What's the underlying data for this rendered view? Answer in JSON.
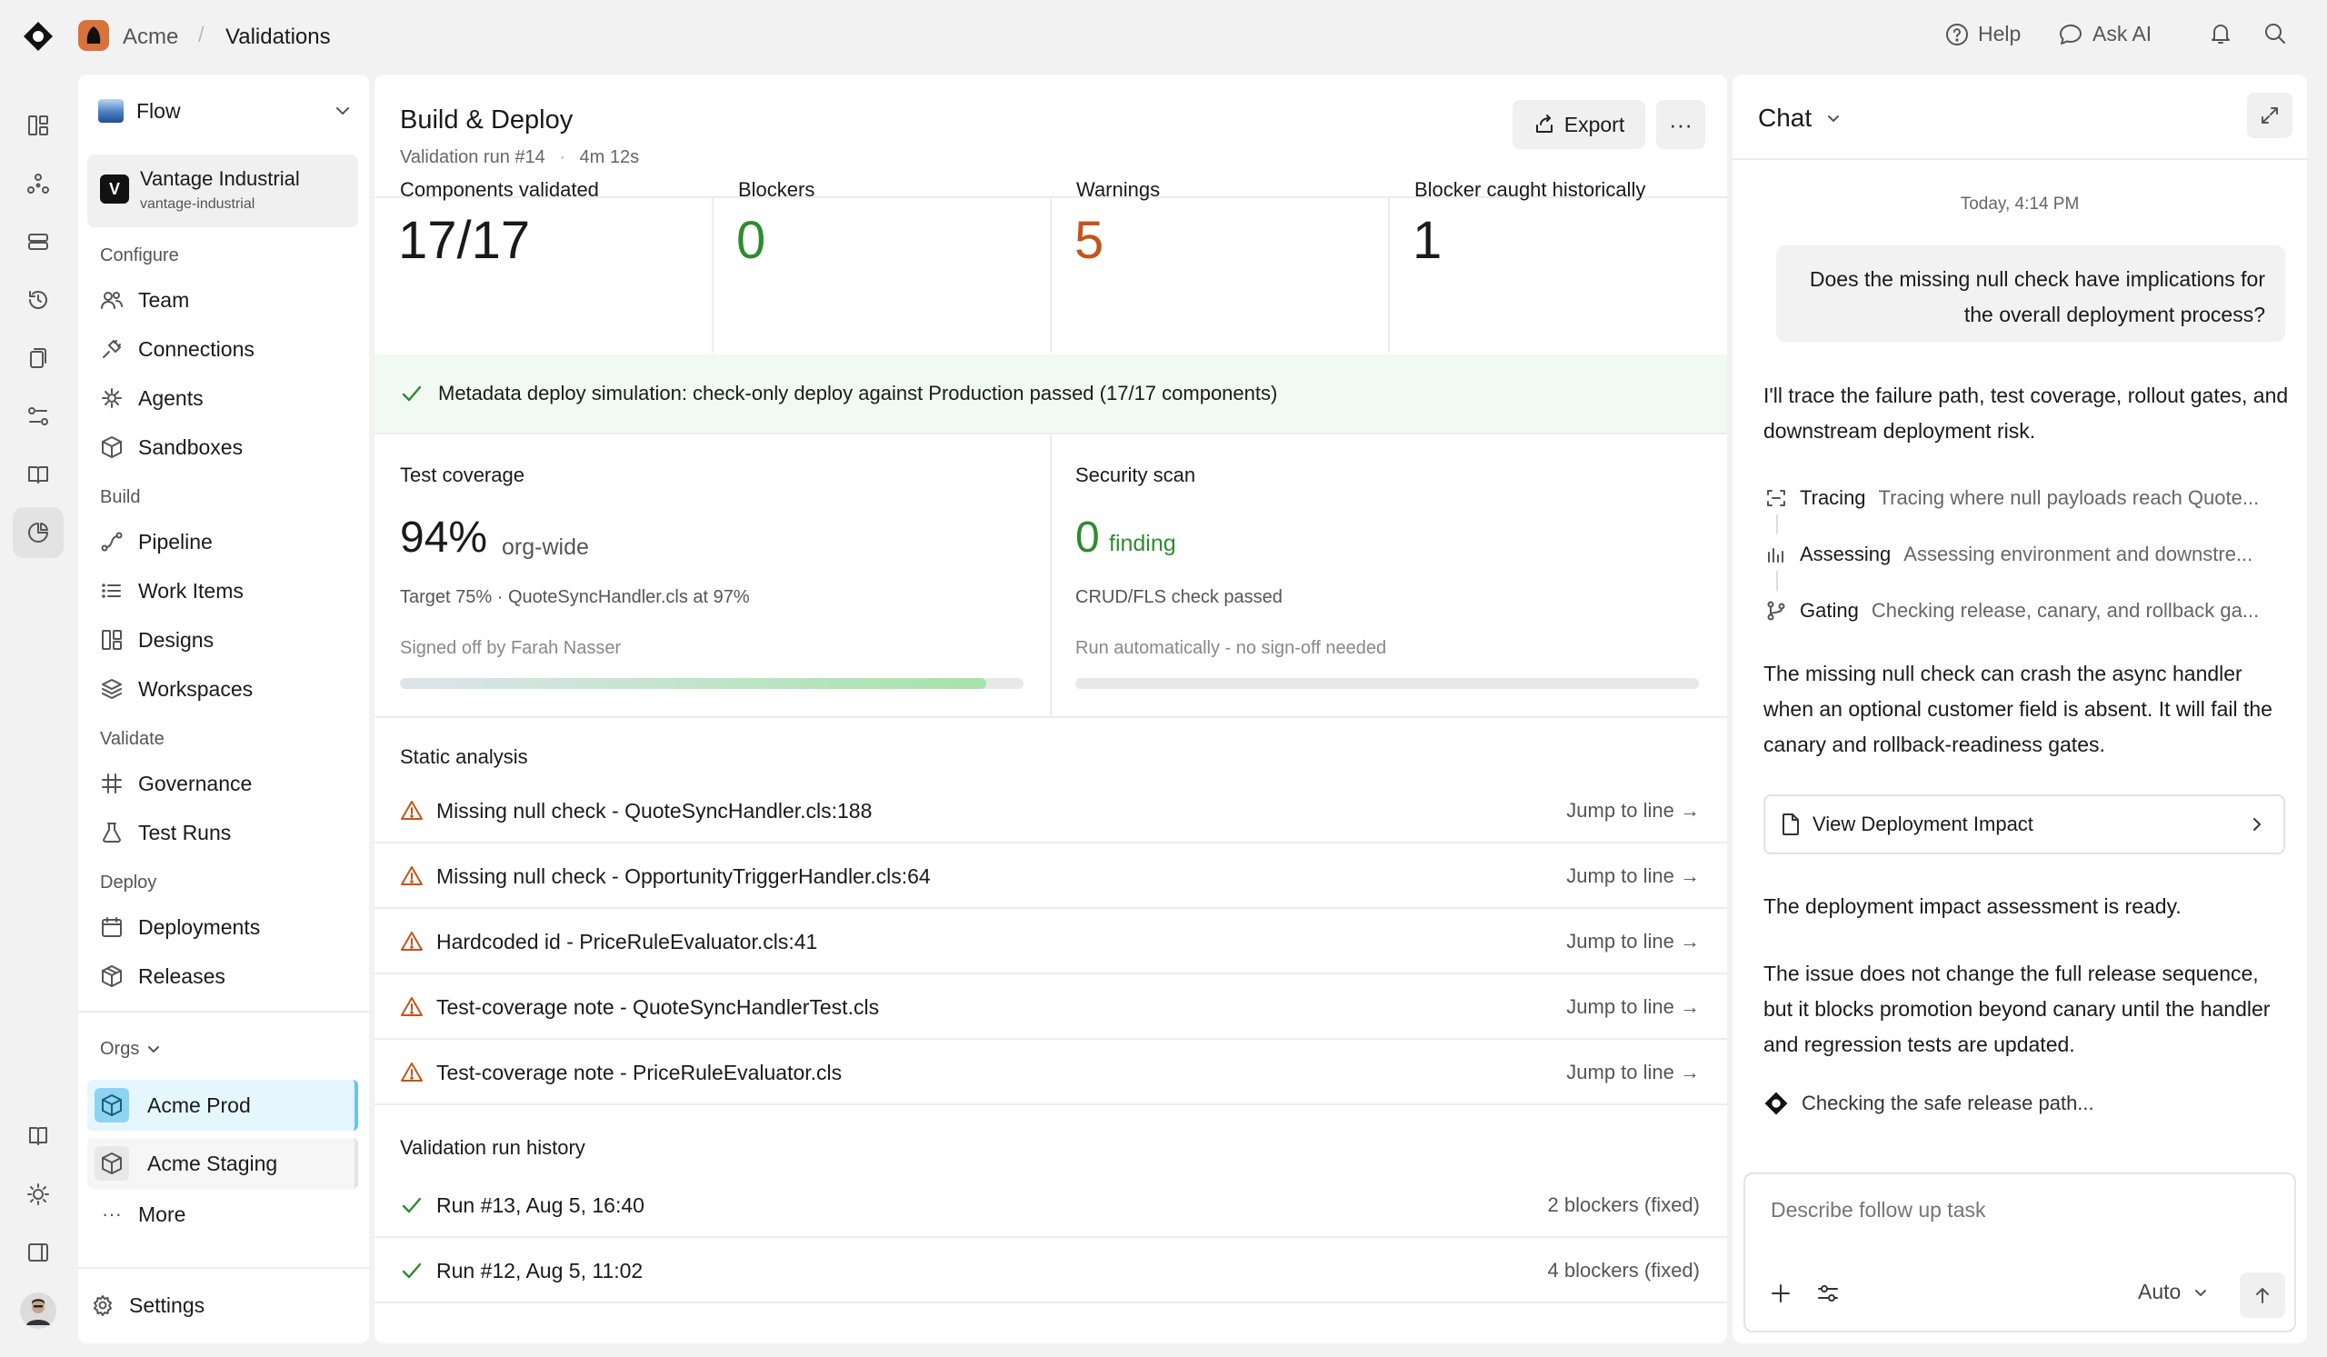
{
  "breadcrumb": {
    "org": "Acme",
    "separator": "/",
    "page": "Validations"
  },
  "topbar": {
    "help": "Help",
    "ask_ai": "Ask AI"
  },
  "sidebar": {
    "flow_label": "Flow",
    "workspace": {
      "initial": "V",
      "name": "Vantage Industrial",
      "slug": "vantage-industrial"
    },
    "sections": {
      "configure": "Configure",
      "build": "Build",
      "validate": "Validate",
      "deploy": "Deploy",
      "orgs": "Orgs"
    },
    "items": {
      "team": "Team",
      "connections": "Connections",
      "agents": "Agents",
      "sandboxes": "Sandboxes",
      "pipeline": "Pipeline",
      "work_items": "Work Items",
      "designs": "Designs",
      "workspaces": "Workspaces",
      "governance": "Governance",
      "test_runs": "Test Runs",
      "deployments": "Deployments",
      "releases": "Releases"
    },
    "orgs": [
      "Acme Prod",
      "Acme Staging"
    ],
    "more": "More",
    "settings": "Settings"
  },
  "main": {
    "title": "Build & Deploy",
    "run": "Validation run #14",
    "dot": "·",
    "duration": "4m 12s",
    "export": "Export",
    "more": "···",
    "stats": [
      {
        "label": "Components validated",
        "value": "17/17",
        "color": "#1a1a1a"
      },
      {
        "label": "Blockers",
        "value": "0",
        "color": "#2e8b2e"
      },
      {
        "label": "Warnings",
        "value": "5",
        "color": "#c4541a"
      },
      {
        "label": "Blocker caught historically",
        "value": "1",
        "color": "#1a1a1a"
      }
    ],
    "banner": "Metadata deploy simulation: check-only deploy against Production passed (17/17 components)",
    "coverage": {
      "title": "Test coverage",
      "value": "94%",
      "suffix": "org-wide",
      "detail": "Target 75% · QuoteSyncHandler.cls at 97%",
      "signoff": "Signed off by Farah Nasser",
      "progress": 0.94
    },
    "security": {
      "title": "Security scan",
      "value": "0",
      "suffix": "finding",
      "detail": "CRUD/FLS check passed",
      "signoff": "Run automatically - no sign-off needed",
      "progress": 0
    },
    "static_analysis": {
      "title": "Static analysis",
      "jump_label": "Jump to line →",
      "rows": [
        "Missing null check - QuoteSyncHandler.cls:188",
        "Missing null check - OpportunityTriggerHandler.cls:64",
        "Hardcoded id - PriceRuleEvaluator.cls:41",
        "Test-coverage note - QuoteSyncHandlerTest.cls",
        "Test-coverage note - PriceRuleEvaluator.cls"
      ]
    },
    "history": {
      "title": "Validation run history",
      "rows": [
        {
          "run": "Run #13, Aug 5, 16:40",
          "result": "2 blockers (fixed)"
        },
        {
          "run": "Run #12, Aug 5, 11:02",
          "result": "4 blockers (fixed)"
        }
      ]
    }
  },
  "chat": {
    "title": "Chat",
    "timestamp": "Today, 4:14 PM",
    "user_message": "Does the missing null check have implications for the overall deployment process?",
    "intro": "I'll trace the failure path, test coverage, rollout gates, and downstream deployment risk.",
    "steps": [
      {
        "name": "Tracing",
        "desc": "Tracing where null payloads reach Quote...",
        "icon": "scan-icon"
      },
      {
        "name": "Assessing",
        "desc": "Assessing environment and downstre...",
        "icon": "bars-icon"
      },
      {
        "name": "Gating",
        "desc": "Checking release, canary, and rollback ga...",
        "icon": "branch-icon"
      }
    ],
    "answer": "The missing null check can crash the async handler when an optional customer field is absent. It will fail the canary and rollback-readiness gates.",
    "deploy_card": "View Deployment Impact",
    "ready": "The deployment impact assessment is ready.",
    "summary": "The issue does not change the full release sequence, but it blocks promotion beyond canary until the handler and regression tests are updated.",
    "checking": "Checking the safe release path...",
    "placeholder": "Describe follow up task",
    "mode": "Auto"
  }
}
